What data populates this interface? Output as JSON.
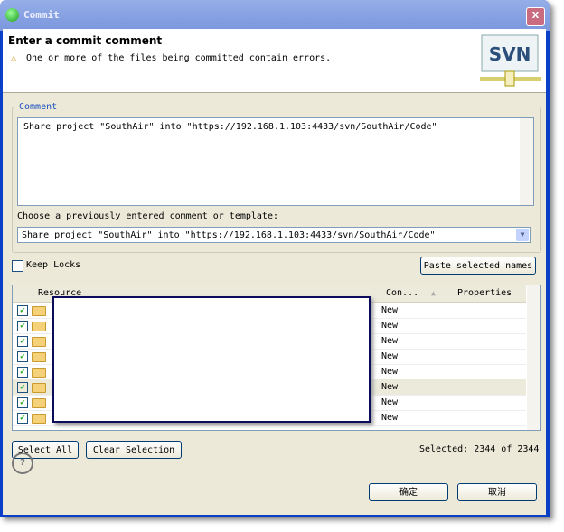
{
  "window": {
    "title": "Commit",
    "close": "X"
  },
  "header": {
    "title": "Enter a commit comment",
    "warning": "One or more of the files being committed contain errors.",
    "logo": "SVN"
  },
  "comment": {
    "group_label": "Comment",
    "value": "Share project \"SouthAir\" into \"https://192.168.1.103:4433/svn/SouthAir/Code\"",
    "template_label": "Choose a previously entered comment or template:",
    "template_value": "Share project \"SouthAir\" into \"https://192.168.1.103:4433/svn/SouthAir/Code\""
  },
  "keep_locks": {
    "label": "Keep Locks",
    "checked": false
  },
  "paste_button": "Paste selected names",
  "table": {
    "columns": [
      "Resource",
      "Con...",
      "Properties"
    ],
    "rows": [
      {
        "checked": true,
        "icon": "folder",
        "status": "New"
      },
      {
        "checked": true,
        "icon": "folder-error",
        "status": "New"
      },
      {
        "checked": true,
        "icon": "folder",
        "status": "New"
      },
      {
        "checked": true,
        "icon": "folder-warning",
        "status": "New"
      },
      {
        "checked": true,
        "icon": "folder",
        "status": "New"
      },
      {
        "checked": true,
        "icon": "folder",
        "status": "New"
      },
      {
        "checked": true,
        "icon": "folder",
        "status": "New"
      },
      {
        "checked": true,
        "icon": "folder",
        "status": "New"
      }
    ]
  },
  "select_all": "Select All",
  "clear_selection": "Clear Selection",
  "selected": "Selected: 2344 of 2344",
  "ok": "确定",
  "cancel": "取消"
}
